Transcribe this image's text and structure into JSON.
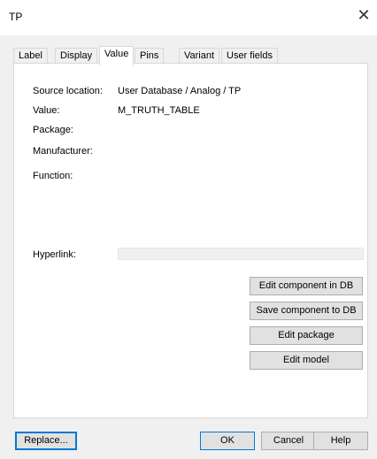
{
  "window": {
    "title": "TP"
  },
  "tabs": [
    {
      "label": "Label"
    },
    {
      "label": "Display"
    },
    {
      "label": "Value"
    },
    {
      "label": "Pins"
    },
    {
      "label": "Variant"
    },
    {
      "label": "User fields"
    }
  ],
  "fields": {
    "source_location": {
      "label": "Source location:",
      "value": "User Database / Analog / TP"
    },
    "value": {
      "label": "Value:",
      "value": "M_TRUTH_TABLE"
    },
    "package": {
      "label": "Package:"
    },
    "manufacturer": {
      "label": "Manufacturer:"
    },
    "function": {
      "label": "Function:"
    },
    "hyperlink": {
      "label": "Hyperlink:",
      "value": ""
    }
  },
  "actions": {
    "edit_component": "Edit component in DB",
    "save_component": "Save component to DB",
    "edit_package": "Edit package",
    "edit_model": "Edit model"
  },
  "footer": {
    "replace": "Replace...",
    "ok": "OK",
    "cancel": "Cancel",
    "help": "Help"
  }
}
